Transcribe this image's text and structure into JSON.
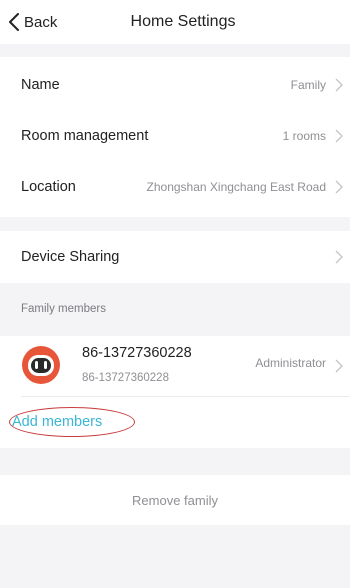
{
  "nav": {
    "back_label": "Back",
    "title": "Home Settings",
    "back_icon": "chevron-left-icon"
  },
  "settings": [
    {
      "key": "name",
      "label": "Name",
      "value": "Family"
    },
    {
      "key": "rooms",
      "label": "Room management",
      "value": "1 rooms"
    },
    {
      "key": "location",
      "label": "Location",
      "value": "Zhongshan Xingchang East Road"
    }
  ],
  "device_sharing": {
    "label": "Device Sharing"
  },
  "family": {
    "header": "Family members",
    "members": [
      {
        "name": "86-13727360228",
        "phone": "86-13727360228",
        "role": "Administrator",
        "avatar_icon": "robot-avatar-icon"
      }
    ],
    "add_label": "Add members"
  },
  "remove_label": "Remove family",
  "colors": {
    "accent": "#3bb6d6",
    "background": "#f4f4f6",
    "annotation": "#c93b3b",
    "avatar": "#e8563a"
  }
}
